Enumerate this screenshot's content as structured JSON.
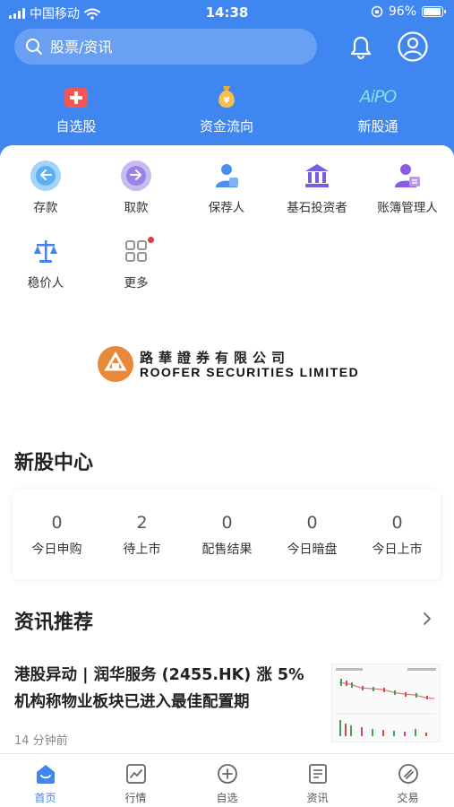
{
  "status_bar": {
    "carrier": "中国移动",
    "time": "14:38",
    "battery": "96%",
    "battery_level": 0.96
  },
  "search": {
    "placeholder": "股票/资讯"
  },
  "top_nav": [
    {
      "label": "自选股",
      "icon": "favorite-stock-icon"
    },
    {
      "label": "资金流向",
      "icon": "money-bag-icon"
    },
    {
      "label": "新股通",
      "icon": "aipo-icon",
      "icon_text": "AiPO"
    }
  ],
  "services": [
    {
      "label": "存款",
      "icon": "deposit-icon",
      "color": "#5ab0f0"
    },
    {
      "label": "取款",
      "icon": "withdraw-icon",
      "color": "#9a83e6"
    },
    {
      "label": "保荐人",
      "icon": "sponsor-icon",
      "color": "#4a8ff0"
    },
    {
      "label": "基石投资者",
      "icon": "cornerstone-investor-icon",
      "color": "#7b5de0"
    },
    {
      "label": "账簿管理人",
      "icon": "bookrunner-icon",
      "color": "#8a5ce6"
    },
    {
      "label": "稳价人",
      "icon": "stabilizer-icon",
      "color": "#4a7ff0"
    },
    {
      "label": "更多",
      "icon": "more-grid-icon",
      "color": "#888888",
      "badge": true
    }
  ],
  "banner": {
    "cn": "路華證券有限公司",
    "en": "ROOFER SECURITIES LIMITED"
  },
  "ipo_center": {
    "title": "新股中心",
    "stats": [
      {
        "value": "0",
        "label": "今日申购"
      },
      {
        "value": "2",
        "label": "待上市"
      },
      {
        "value": "0",
        "label": "配售结果"
      },
      {
        "value": "0",
        "label": "今日暗盘"
      },
      {
        "value": "0",
        "label": "今日上市"
      }
    ]
  },
  "news": {
    "title": "资讯推荐",
    "item": {
      "line1": "港股异动 | 润华服务 (2455.HK) 涨 5%",
      "line2": "机构称物业板块已进入最佳配置期",
      "time": "14 分钟前"
    }
  },
  "tabs": [
    {
      "label": "首页",
      "icon": "home-icon",
      "active": true
    },
    {
      "label": "行情",
      "icon": "market-chart-icon",
      "active": false
    },
    {
      "label": "自选",
      "icon": "add-watchlist-icon",
      "active": false
    },
    {
      "label": "资讯",
      "icon": "news-icon",
      "active": false
    },
    {
      "label": "交易",
      "icon": "trade-icon",
      "active": false
    }
  ],
  "colors": {
    "primary": "#3f86f0",
    "badge": "#e83a3a"
  }
}
